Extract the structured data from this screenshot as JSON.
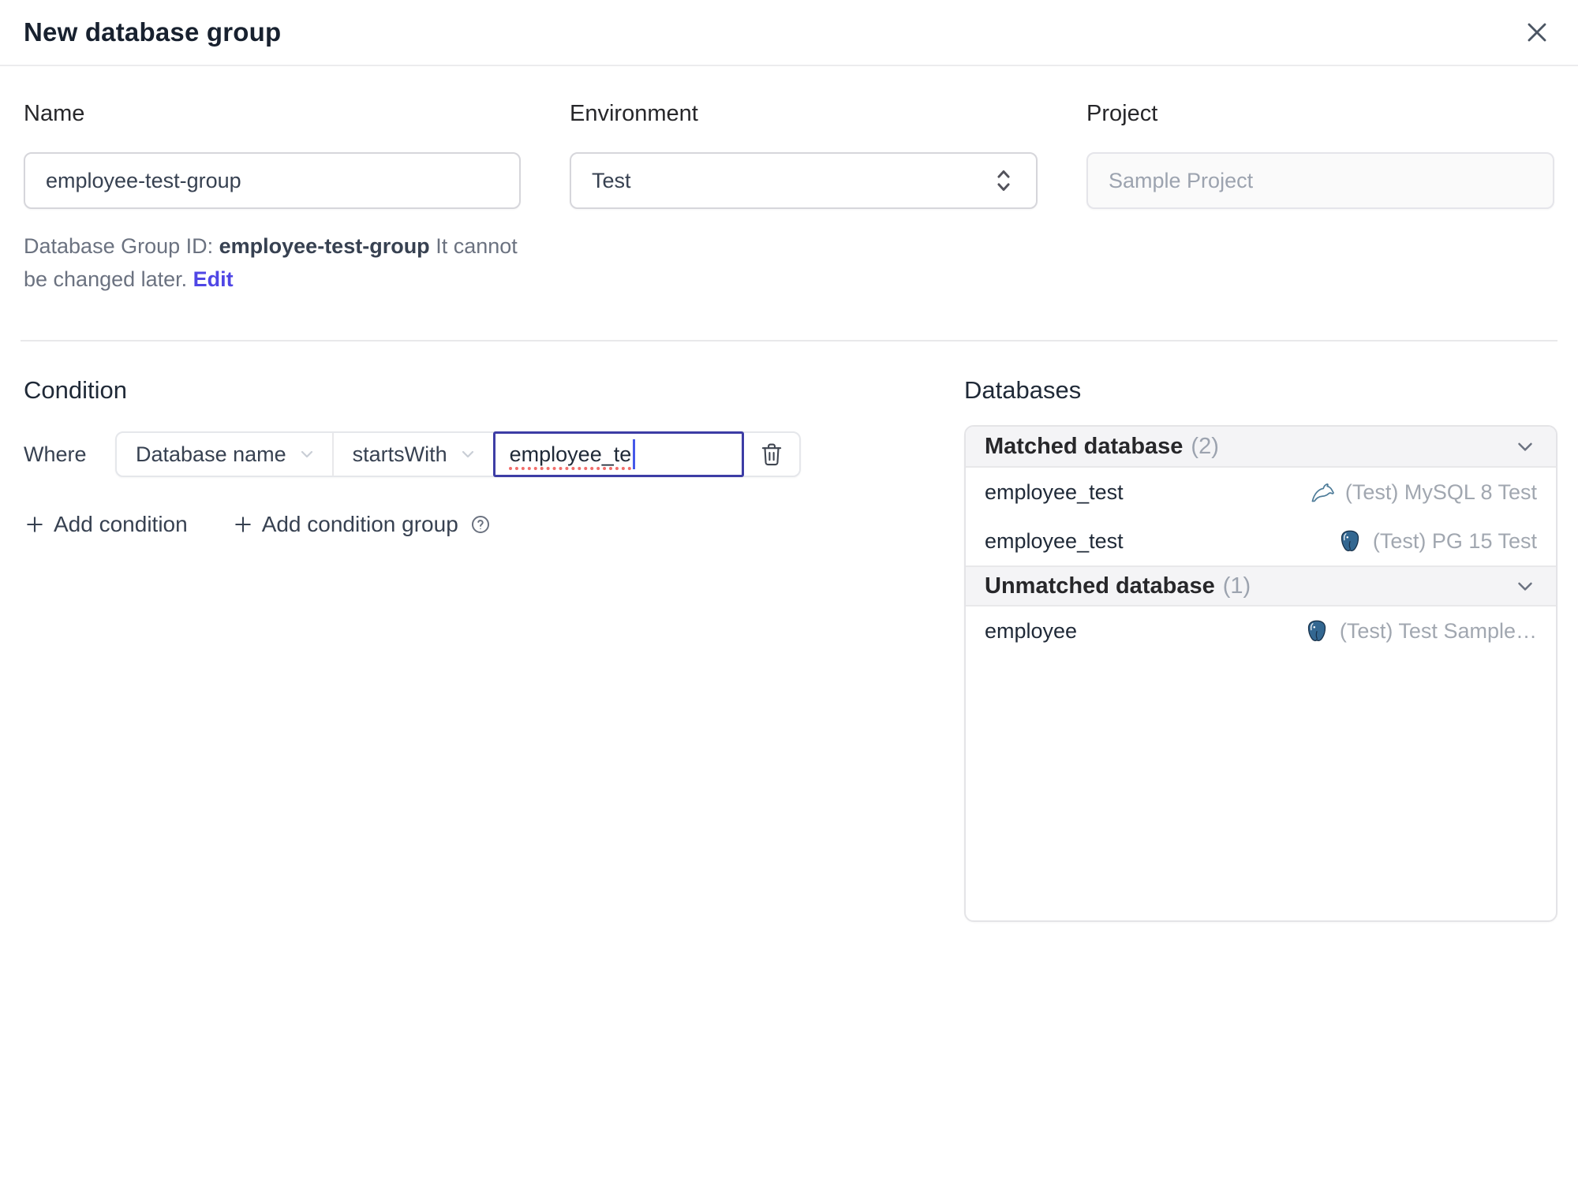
{
  "dialog": {
    "title": "New database group"
  },
  "form": {
    "name": {
      "label": "Name",
      "value": "employee-test-group"
    },
    "environment": {
      "label": "Environment",
      "value": "Test"
    },
    "project": {
      "label": "Project",
      "value": "Sample Project"
    },
    "group_id_help": {
      "prefix": "Database Group ID: ",
      "id": "employee-test-group",
      "suffix": " It cannot be changed later. ",
      "edit_label": "Edit"
    }
  },
  "condition": {
    "heading": "Condition",
    "where_label": "Where",
    "field_selected": "Database name",
    "operator_selected": "startsWith",
    "value": "employee_te",
    "add_condition_label": "Add condition",
    "add_condition_group_label": "Add condition group"
  },
  "databases": {
    "heading": "Databases",
    "groups": [
      {
        "label": "Matched database",
        "count": "(2)",
        "rows": [
          {
            "name": "employee_test",
            "engine": "mysql",
            "instance": "(Test) MySQL 8 Test"
          },
          {
            "name": "employee_test",
            "engine": "postgresql",
            "instance": "(Test) PG 15 Test"
          }
        ]
      },
      {
        "label": "Unmatched database",
        "count": "(1)",
        "rows": [
          {
            "name": "employee",
            "engine": "postgresql",
            "instance": "(Test) Test Sample…"
          }
        ]
      }
    ]
  },
  "colors": {
    "accent_indigo": "#4f46e5",
    "focused_border": "#3d3da5",
    "spellcheck_red": "#ef5350",
    "mysql_teal": "#4e7c99",
    "postgres_blue": "#336791",
    "header_gray_bg": "#f4f4f6"
  }
}
